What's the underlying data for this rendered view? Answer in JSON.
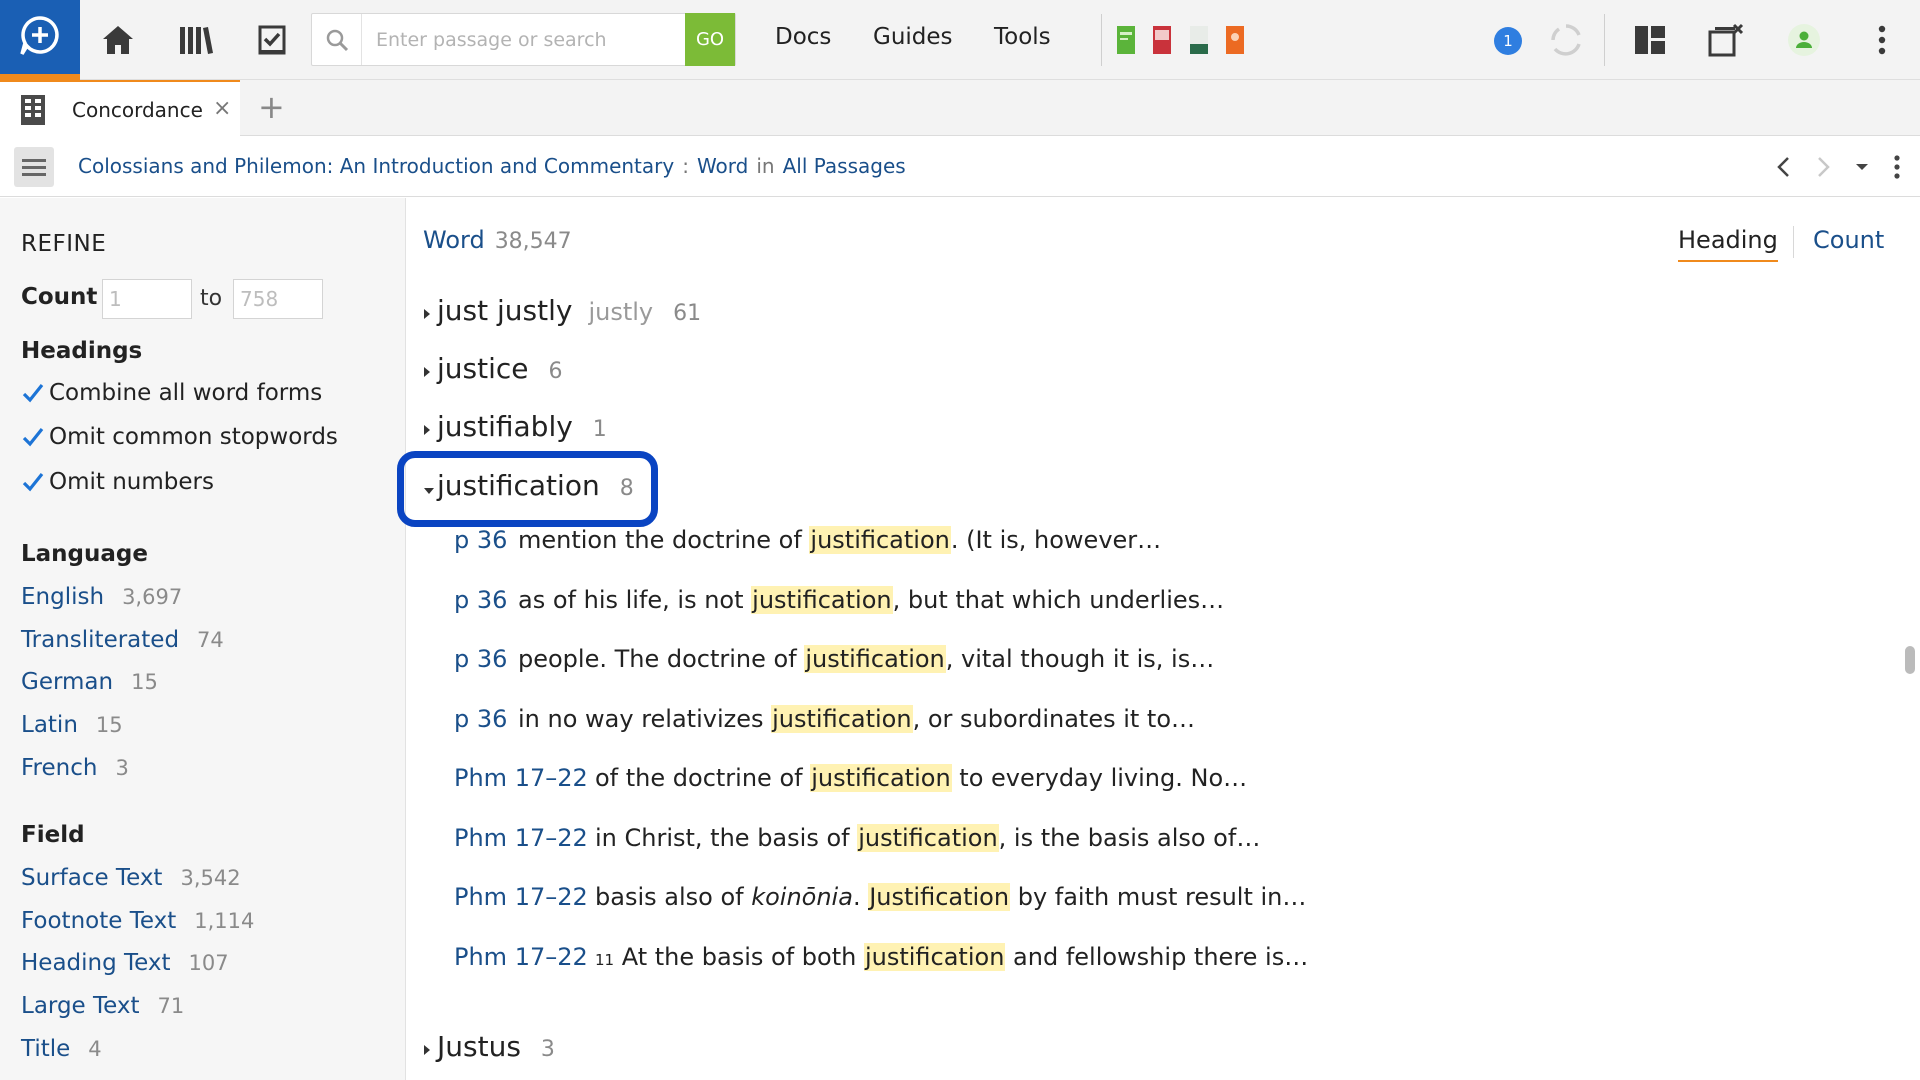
{
  "search": {
    "placeholder": "Enter passage or search",
    "go_label": "GO"
  },
  "menu": {
    "docs": "Docs",
    "guides": "Guides",
    "tools": "Tools"
  },
  "notifications": {
    "count": "1"
  },
  "tab": {
    "label": "Concordance",
    "close": "×",
    "add": "+"
  },
  "breadcrumb": {
    "resource": "Colossians and Philemon: An Introduction and Commentary",
    "sep": ":",
    "field": "Word",
    "in": "in",
    "scope": "All Passages"
  },
  "refine": {
    "title": "REFINE",
    "count_label": "Count",
    "count_from": "1",
    "count_to_label": "to",
    "count_to": "758",
    "headings_label": "Headings",
    "options": [
      {
        "label": "Combine all word forms",
        "checked": true
      },
      {
        "label": "Omit common stopwords",
        "checked": true
      },
      {
        "label": "Omit numbers",
        "checked": true
      }
    ],
    "language_label": "Language",
    "languages": [
      {
        "label": "English",
        "count": "3,697"
      },
      {
        "label": "Transliterated",
        "count": "74"
      },
      {
        "label": "German",
        "count": "15"
      },
      {
        "label": "Latin",
        "count": "15"
      },
      {
        "label": "French",
        "count": "3"
      }
    ],
    "field_label": "Field",
    "fields": [
      {
        "label": "Surface Text",
        "count": "3,542"
      },
      {
        "label": "Footnote Text",
        "count": "1,114"
      },
      {
        "label": "Heading Text",
        "count": "107"
      },
      {
        "label": "Large Text",
        "count": "71"
      },
      {
        "label": "Title",
        "count": "4"
      }
    ]
  },
  "main": {
    "header_label": "Word",
    "header_count": "38,547",
    "view_heading": "Heading",
    "view_count": "Count",
    "entries": [
      {
        "word": "just justly",
        "alt": "justly",
        "count": "61"
      },
      {
        "word": "justice",
        "alt": "",
        "count": "6"
      },
      {
        "word": "justifiably",
        "alt": "",
        "count": "1"
      },
      {
        "word": "justification",
        "alt": "",
        "count": "8"
      }
    ],
    "hits": [
      {
        "ref": "p 36",
        "before": "mention the doctrine of ",
        "term": "justification",
        "after": ". (It is, however…"
      },
      {
        "ref": "p 36",
        "before": "as of his life, is not ",
        "term": "justification",
        "after": ", but that which underlies…"
      },
      {
        "ref": "p 36",
        "before": "people. The doctrine of ",
        "term": "justification",
        "after": ", vital though it is, is…"
      },
      {
        "ref": "p 36",
        "before": "in no way relativizes ",
        "term": "justification",
        "after": ", or subordinates it to…"
      },
      {
        "ref": "Phm 17–22",
        "before": "of the doctrine of ",
        "term": "justification",
        "after": " to everyday living. No…"
      },
      {
        "ref": "Phm 17–22",
        "before": "in Christ, the basis of ",
        "term": "justification",
        "after": ", is the basis also of…"
      },
      {
        "ref": "Phm 17–22",
        "before": "basis also of ",
        "em": "koinōnia",
        "mid": ". ",
        "term": "Justification",
        "after": " by faith must result in…"
      },
      {
        "ref": "Phm 17–22",
        "sup": "11",
        "before": " At the basis of both ",
        "term": "justification",
        "after": " and fellowship there is…"
      }
    ],
    "last_entry": {
      "word": "Justus",
      "count": "3"
    }
  }
}
